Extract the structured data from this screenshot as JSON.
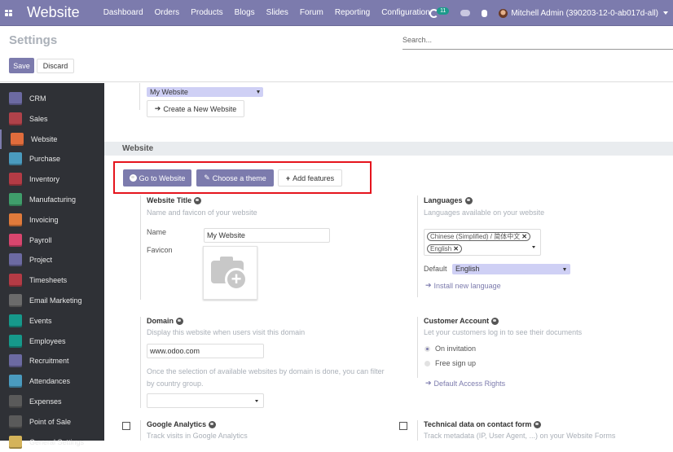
{
  "navbar": {
    "app_title": "Website",
    "menu": [
      "Dashboard",
      "Orders",
      "Products",
      "Blogs",
      "Slides",
      "Forum",
      "Reporting",
      "Configuration"
    ],
    "activity_count": "11",
    "user_name": "Mitchell Admin (390203-12-0-ab017d-all)"
  },
  "control_panel": {
    "title": "Settings",
    "search_placeholder": "Search...",
    "save_label": "Save",
    "discard_label": "Discard"
  },
  "sidebar": {
    "active": "Website",
    "items": [
      {
        "label": "CRM",
        "icon": "crm-icon",
        "color": "#6c6aa2"
      },
      {
        "label": "Sales",
        "icon": "sales-chart-icon",
        "color": "#b0424a"
      },
      {
        "label": "Website",
        "icon": "globe-icon",
        "color": "#e06c3c"
      },
      {
        "label": "Purchase",
        "icon": "purchase-card-icon",
        "color": "#4a9bbf"
      },
      {
        "label": "Inventory",
        "icon": "inventory-box-icon",
        "color": "#b43b45"
      },
      {
        "label": "Manufacturing",
        "icon": "wrench-icon",
        "color": "#3f9e6b"
      },
      {
        "label": "Invoicing",
        "icon": "invoice-icon",
        "color": "#e07a3b"
      },
      {
        "label": "Payroll",
        "icon": "payroll-icon",
        "color": "#d8466e"
      },
      {
        "label": "Project",
        "icon": "puzzle-icon",
        "color": "#6c6aa2"
      },
      {
        "label": "Timesheets",
        "icon": "stopwatch-icon",
        "color": "#b43b45"
      },
      {
        "label": "Email Marketing",
        "icon": "paper-plane-icon",
        "color": "#6b6b6b"
      },
      {
        "label": "Events",
        "icon": "ticket-icon",
        "color": "#16998b"
      },
      {
        "label": "Employees",
        "icon": "people-icon",
        "color": "#16998b"
      },
      {
        "label": "Recruitment",
        "icon": "magnifier-person-icon",
        "color": "#6c6aa2"
      },
      {
        "label": "Attendances",
        "icon": "attendance-icon",
        "color": "#4a9bbf"
      },
      {
        "label": "Expenses",
        "icon": "expenses-icon",
        "color": "#5a5a5a"
      },
      {
        "label": "Point of Sale",
        "icon": "store-icon",
        "color": "#5a5a5a"
      },
      {
        "label": "General Settings",
        "icon": "gear-icon",
        "color": "#d4b35a"
      }
    ]
  },
  "content": {
    "website_select": "My Website",
    "create_website_label": "Create a New Website",
    "section_title": "Website",
    "buttons": {
      "go_to_website": "Go to Website",
      "choose_theme": "Choose a theme",
      "add_features": "Add features"
    },
    "website_title": {
      "title": "Website Title",
      "desc": "Name and favicon of your website",
      "name_label": "Name",
      "name_value": "My Website",
      "favicon_label": "Favicon"
    },
    "languages": {
      "title": "Languages",
      "desc": "Languages available on your website",
      "tags": [
        "Chinese (Simplified) / 简体中文",
        "English"
      ],
      "default_label": "Default",
      "default_value": "English",
      "install_link": "Install new language"
    },
    "domain": {
      "title": "Domain",
      "desc": "Display this website when users visit this domain",
      "value": "www.odoo.com",
      "note": "Once the selection of available websites by domain is done, you can filter by country group."
    },
    "customer_account": {
      "title": "Customer Account",
      "desc": "Let your customers log in to see their documents",
      "options": [
        "On invitation",
        "Free sign up"
      ],
      "selected": "On invitation",
      "link": "Default Access Rights"
    },
    "google_analytics": {
      "title": "Google Analytics",
      "desc": "Track visits in Google Analytics",
      "checked": false
    },
    "technical_data": {
      "title": "Technical data on contact form",
      "desc": "Track metadata (IP, User Agent, ...) on your Website Forms",
      "checked": false
    }
  }
}
